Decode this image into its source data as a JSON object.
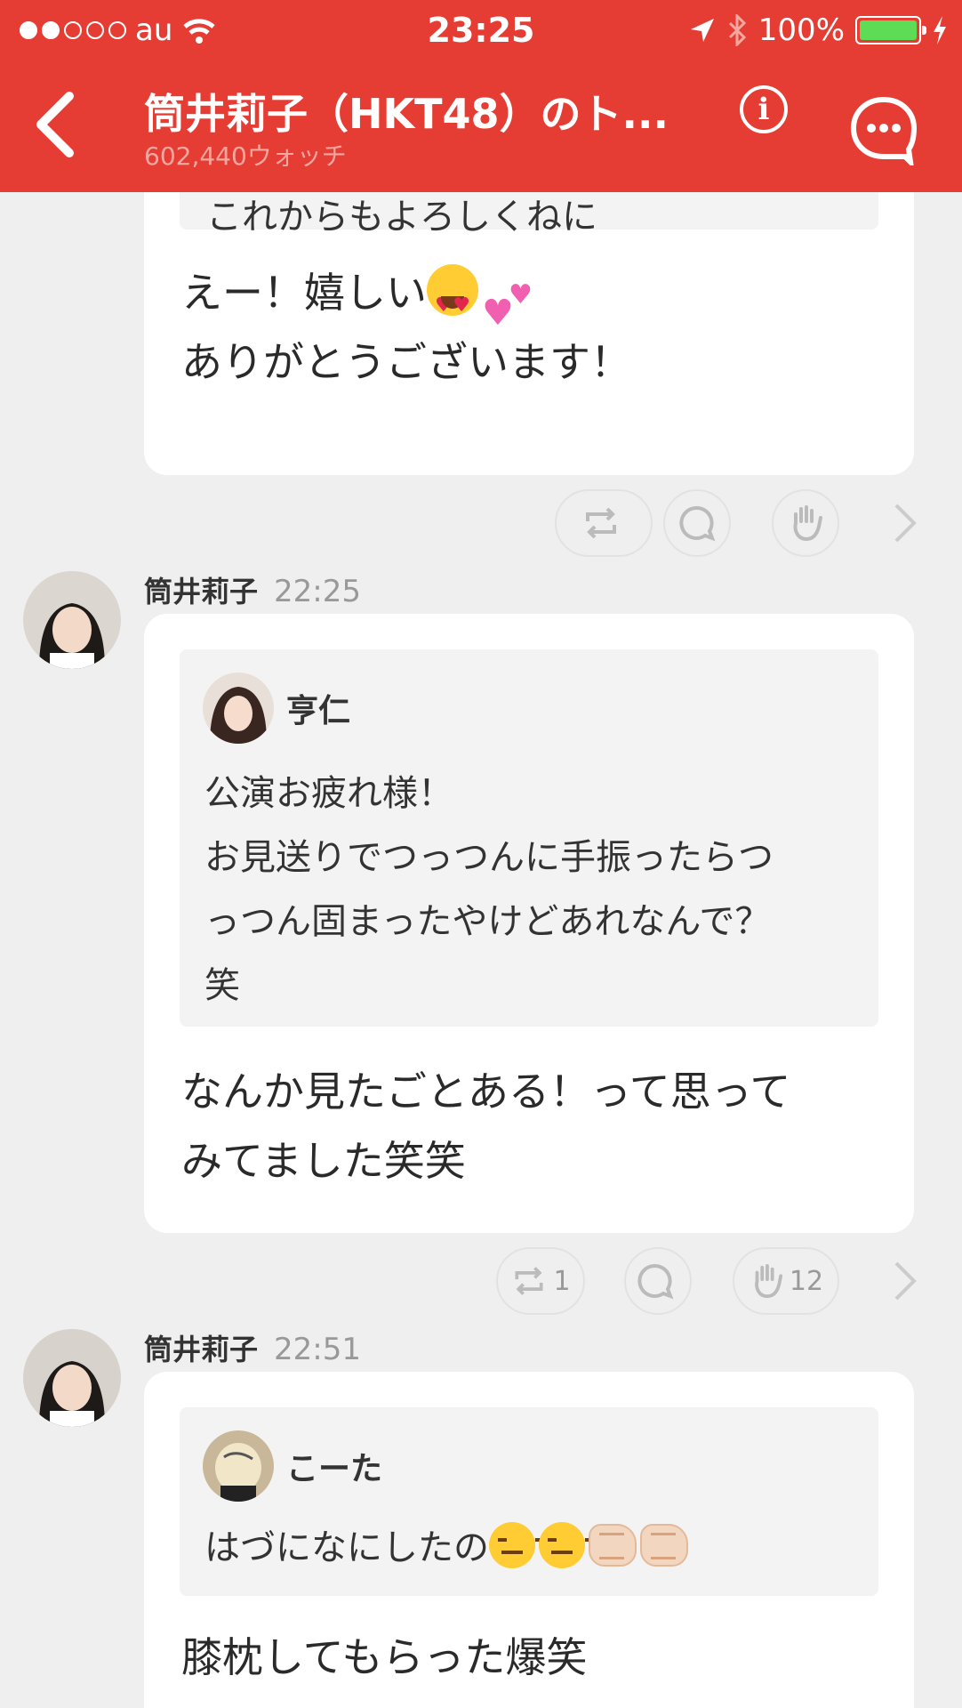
{
  "status_bar": {
    "carrier": "au",
    "time": "23:25",
    "battery": "100%",
    "signal_dots_filled": 2,
    "signal_dots_total": 5
  },
  "nav": {
    "back_icon": "chevron-left-icon",
    "title": "筒井莉子（HKT48）のト...",
    "subtitle": "602,440ウォッチ",
    "info_icon": "info-icon",
    "chat_icon": "chat-bubble-icon"
  },
  "posts": [
    {
      "quote_text": "これからもよろしくねに",
      "reply_line1": "えー！嬉しい",
      "reply_line2": "ありがとうございます！",
      "actions": {
        "repost_count": "",
        "reply_count": "",
        "clap_count": ""
      }
    },
    {
      "author": "筒井莉子",
      "time": "22:25",
      "quote_author": "亨仁",
      "quote_lines": [
        "公演お疲れ様！",
        "お見送りでつっつんに手振ったらつ",
        "っつん固まったやけどあれなんで？",
        "笑"
      ],
      "reply_lines": [
        "なんか見たごとある！って思って",
        "みてました笑笑"
      ],
      "actions": {
        "repost_count": "1",
        "reply_count": "",
        "clap_count": "12"
      }
    },
    {
      "author": "筒井莉子",
      "time": "22:51",
      "quote_author": "こーた",
      "quote_text": "はづになにしたの",
      "reply_text": "膝枕してもらった爆笑"
    }
  ],
  "colors": {
    "brand_red": "#e53d34",
    "background": "#efefef",
    "battery_green": "#5fdc55"
  }
}
